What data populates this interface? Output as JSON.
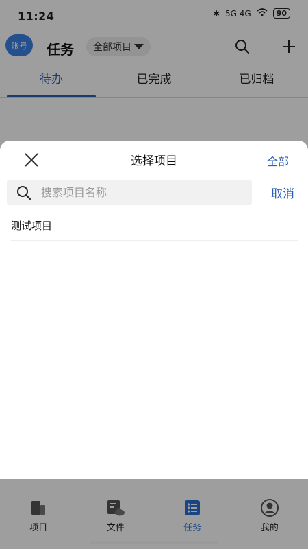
{
  "status_bar": {
    "time": "11:24",
    "signal_text": "5G 4G",
    "battery": "90"
  },
  "header": {
    "avatar_label": "账号",
    "title": "任务",
    "project_filter": "全部项目"
  },
  "tabs": [
    {
      "label": "待办",
      "active": true
    },
    {
      "label": "已完成",
      "active": false
    },
    {
      "label": "已归档",
      "active": false
    }
  ],
  "sheet": {
    "title": "选择项目",
    "all_label": "全部",
    "search_placeholder": "搜索项目名称",
    "cancel_label": "取消",
    "items": [
      {
        "label": "测试项目"
      }
    ]
  },
  "bottom_nav": [
    {
      "label": "项目",
      "icon": "project-icon",
      "active": false
    },
    {
      "label": "文件",
      "icon": "file-icon",
      "active": false
    },
    {
      "label": "任务",
      "icon": "task-list-icon",
      "active": true
    },
    {
      "label": "我的",
      "icon": "profile-icon",
      "active": false
    }
  ],
  "colors": {
    "accent": "#2b5fb4",
    "nav_active": "#2b6fd6",
    "avatar": "#3c82e6"
  }
}
